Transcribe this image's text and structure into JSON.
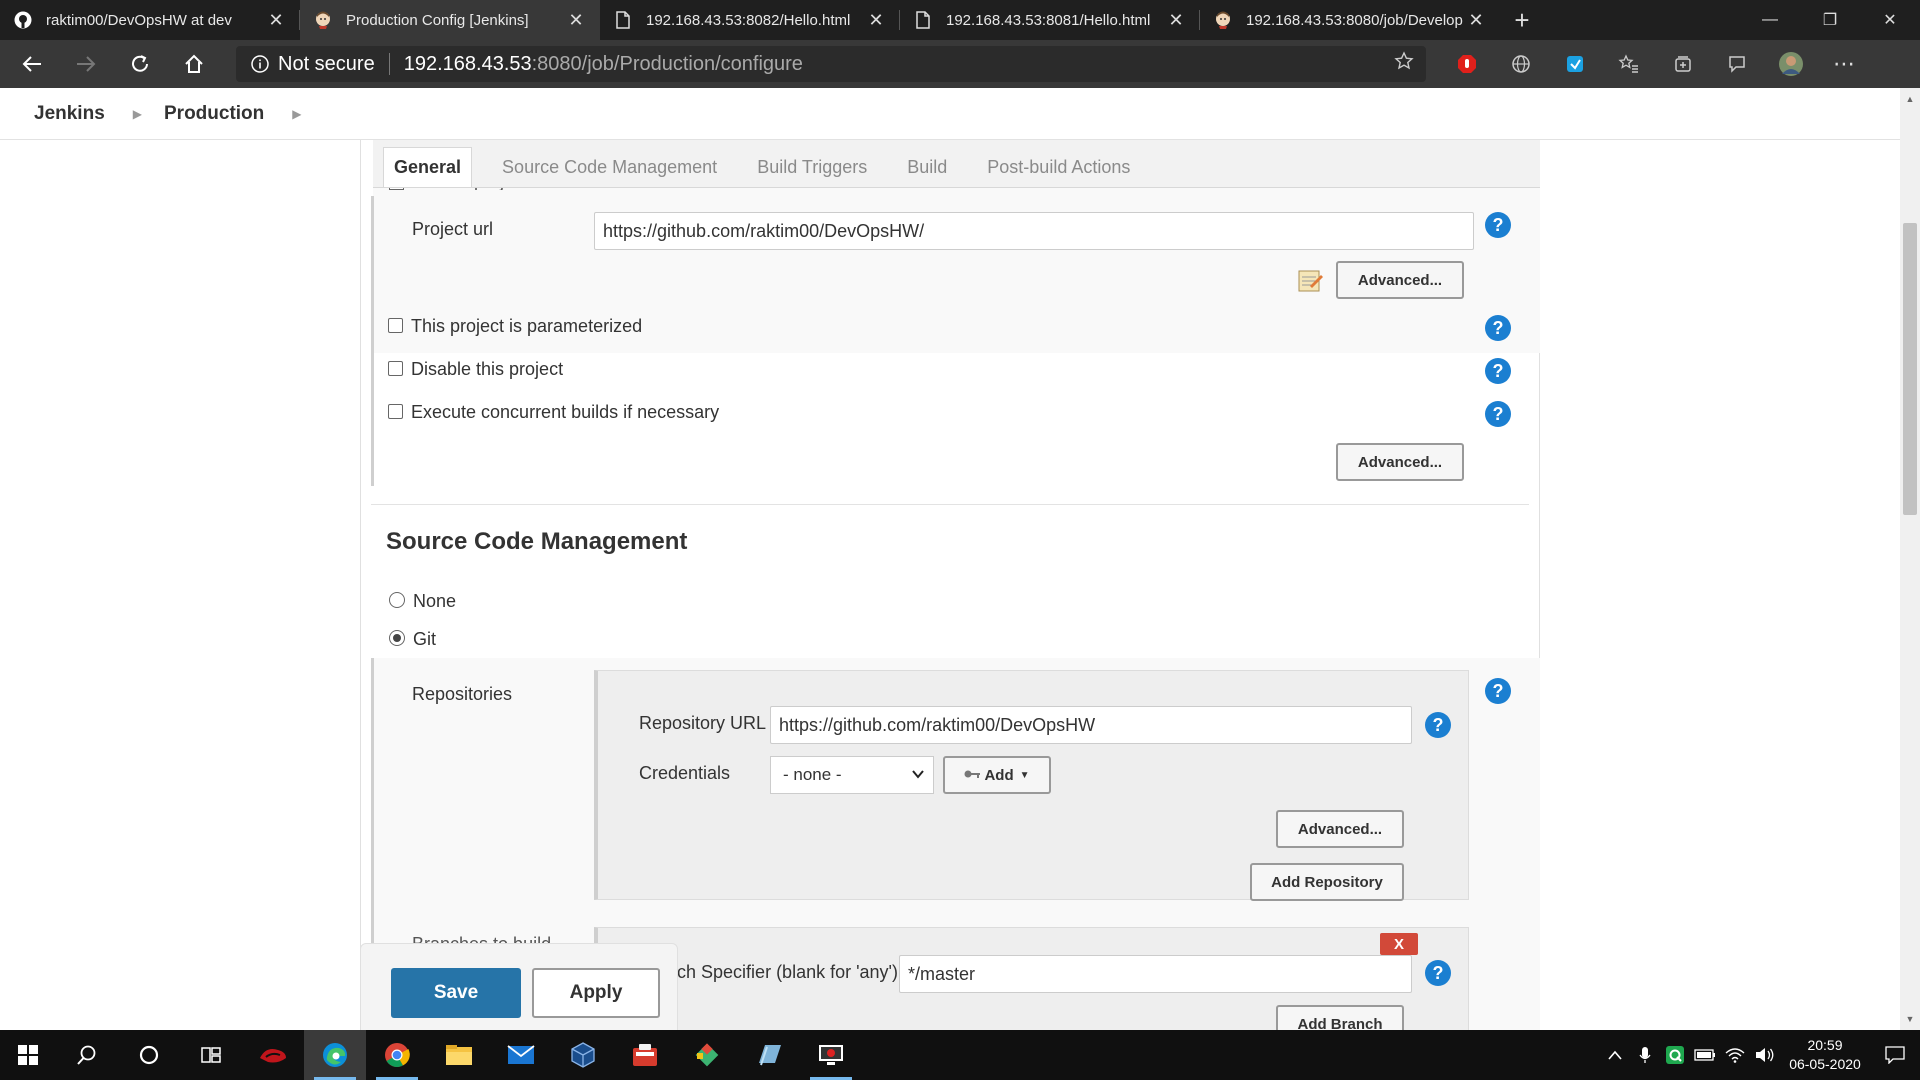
{
  "browser": {
    "tabs": [
      {
        "title": "raktim00/DevOpsHW at dev",
        "icon": "github-icon",
        "active": false
      },
      {
        "title": "Production Config [Jenkins]",
        "icon": "jenkins-icon",
        "active": true
      },
      {
        "title": "192.168.43.53:8082/Hello.html",
        "icon": "page-icon",
        "active": false
      },
      {
        "title": "192.168.43.53:8081/Hello.html",
        "icon": "page-icon",
        "active": false
      },
      {
        "title": "192.168.43.53:8080/job/Develop",
        "icon": "jenkins-icon",
        "active": false
      }
    ],
    "security_label": "Not secure",
    "url_host": "192.168.43.53",
    "url_path": ":8080/job/Production/configure"
  },
  "breadcrumb": {
    "items": [
      "Jenkins",
      "Production"
    ]
  },
  "config_tabs": [
    "General",
    "Source Code Management",
    "Build Triggers",
    "Build",
    "Post-build Actions"
  ],
  "general": {
    "github_project_label": "GitHub project",
    "project_url_label": "Project url",
    "project_url_value": "https://github.com/raktim00/DevOpsHW/",
    "advanced_label": "Advanced...",
    "options": [
      {
        "label": "This project is parameterized",
        "checked": false
      },
      {
        "label": "Disable this project",
        "checked": false
      },
      {
        "label": "Execute concurrent builds if necessary",
        "checked": false
      }
    ],
    "advanced2_label": "Advanced..."
  },
  "scm": {
    "title": "Source Code Management",
    "options": [
      {
        "label": "None",
        "selected": false
      },
      {
        "label": "Git",
        "selected": true
      }
    ],
    "repositories_label": "Repositories",
    "repo_url_label": "Repository URL",
    "repo_url_value": "https://github.com/raktim00/DevOpsHW",
    "credentials_label": "Credentials",
    "credentials_value": "- none -",
    "add_label": "Add",
    "advanced_label": "Advanced...",
    "add_repository_label": "Add Repository",
    "branches_label": "Branches to build",
    "branch_specifier_label": "Branch Specifier (blank for 'any')",
    "branch_specifier_value": "*/master",
    "delete_label": "X",
    "add_branch_label": "Add Branch"
  },
  "actions": {
    "save": "Save",
    "apply": "Apply"
  },
  "taskbar": {
    "time": "20:59",
    "date": "06-05-2020"
  },
  "colors": {
    "primary": "#2674a8",
    "help": "#1b7fd1",
    "danger": "#d24939"
  }
}
